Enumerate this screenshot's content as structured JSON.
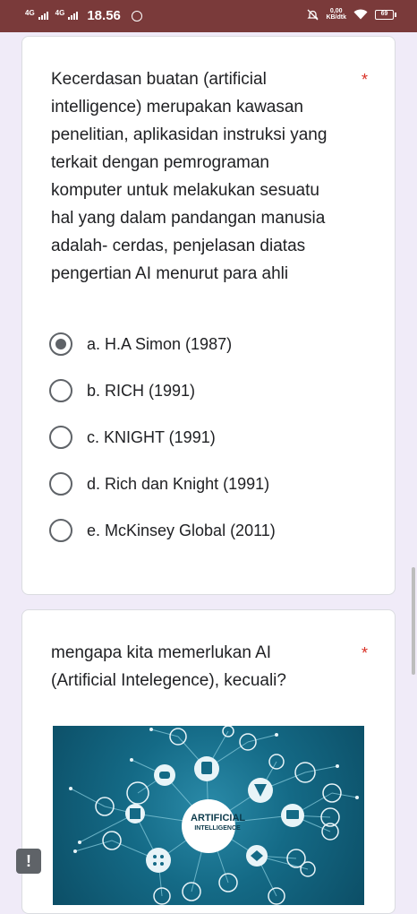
{
  "statusbar": {
    "net1": "4G",
    "net2": "4G",
    "time": "18.56",
    "speed_value": "0,00",
    "speed_unit": "KB/dtk",
    "battery": "69"
  },
  "question1": {
    "text": "Kecerdasan buatan (artificial intelligence) merupakan kawasan penelitian, aplikasidan instruksi yang terkait dengan pemrograman komputer untuk melakukan sesuatu hal yang dalam pandangan manusia adalah- cerdas, penjelasan diatas pengertian AI menurut para ahli",
    "required_mark": "*",
    "options": [
      {
        "label": "a. H.A Simon (1987)",
        "selected": true
      },
      {
        "label": "b. RICH (1991)",
        "selected": false
      },
      {
        "label": "c. KNIGHT (1991)",
        "selected": false
      },
      {
        "label": "d. Rich dan Knight (1991)",
        "selected": false
      },
      {
        "label": "e. McKinsey Global (2011)",
        "selected": false
      }
    ]
  },
  "question2": {
    "text": "mengapa kita memerlukan AI (Artificial Intelegence), kecuali?",
    "required_mark": "*",
    "image_label_line1": "ARTIFICIAL",
    "image_label_line2": "INTELLIGENCE"
  },
  "report_button": "!",
  "colors": {
    "statusbar": "#7a3a3a",
    "background": "#f0ebf8",
    "required": "#d93025",
    "radio": "#5f6368"
  }
}
